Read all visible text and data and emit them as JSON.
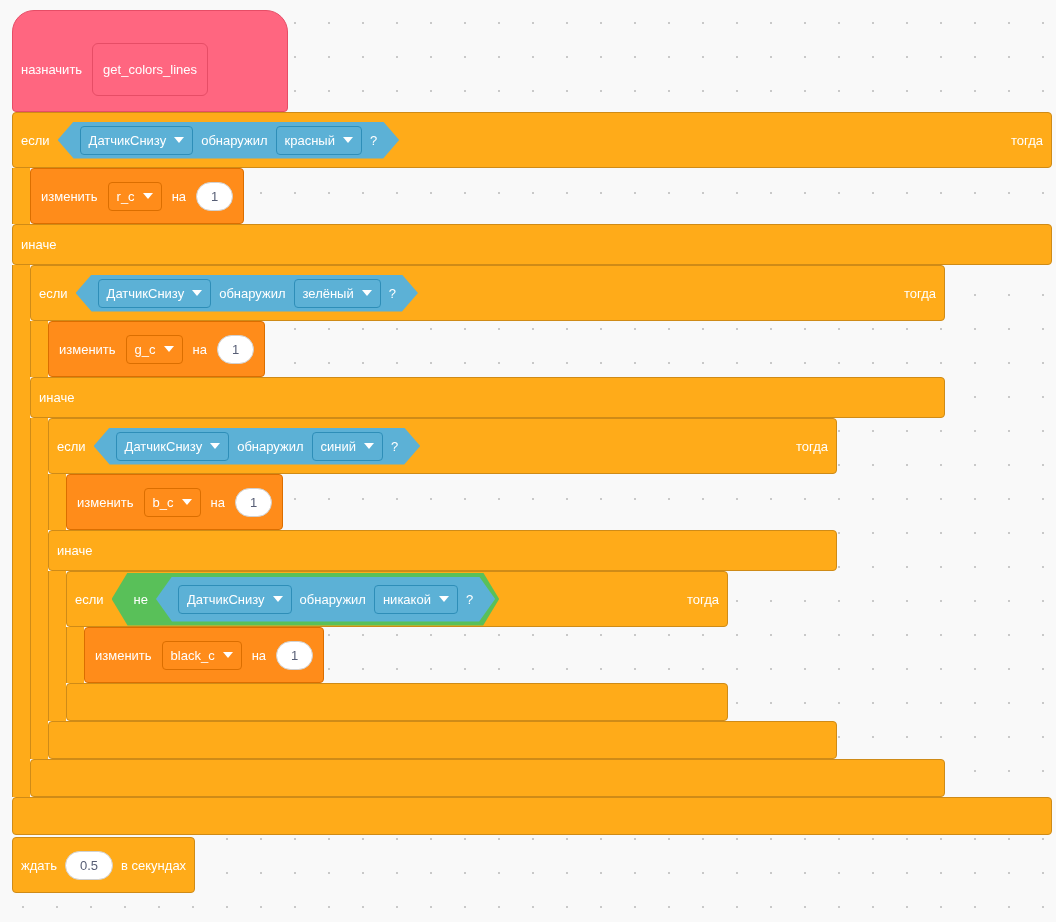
{
  "script": [
    {
      "kind": "set",
      "label": "назначить",
      "value": "get_colors_lines"
    },
    {
      "kind": "if_else",
      "if_label": "если",
      "then_label": "тогда",
      "else_label": "иначе",
      "condition": {
        "kind": "sensing",
        "sensor": "ДатчикСнизу",
        "verb": "обнаружил",
        "option": "красный",
        "mark": "?"
      },
      "then": [
        {
          "kind": "change",
          "label": "изменить",
          "variable": "r_c",
          "by_label": "на",
          "amount": "1"
        }
      ],
      "else": [
        {
          "kind": "if_else",
          "if_label": "если",
          "then_label": "тогда",
          "else_label": "иначе",
          "condition": {
            "kind": "sensing",
            "sensor": "ДатчикСнизу",
            "verb": "обнаружил",
            "option": "зелёный",
            "mark": "?"
          },
          "then": [
            {
              "kind": "change",
              "label": "изменить",
              "variable": "g_c",
              "by_label": "на",
              "amount": "1"
            }
          ],
          "else": [
            {
              "kind": "if_else",
              "if_label": "если",
              "then_label": "тогда",
              "else_label": "иначе",
              "condition": {
                "kind": "sensing",
                "sensor": "ДатчикСнизу",
                "verb": "обнаружил",
                "option": "синий",
                "mark": "?"
              },
              "then": [
                {
                  "kind": "change",
                  "label": "изменить",
                  "variable": "b_c",
                  "by_label": "на",
                  "amount": "1"
                }
              ],
              "else": [
                {
                  "kind": "if",
                  "if_label": "если",
                  "then_label": "тогда",
                  "condition": {
                    "kind": "not",
                    "label": "не",
                    "operand": {
                      "kind": "sensing",
                      "sensor": "ДатчикСнизу",
                      "verb": "обнаружил",
                      "option": "никакой",
                      "mark": "?"
                    }
                  },
                  "then": [
                    {
                      "kind": "change",
                      "label": "изменить",
                      "variable": "black_c",
                      "by_label": "на",
                      "amount": "1"
                    }
                  ]
                }
              ]
            }
          ]
        }
      ]
    },
    {
      "kind": "wait",
      "label": "ждать",
      "value": "0.5",
      "unit": "в секундах"
    }
  ]
}
